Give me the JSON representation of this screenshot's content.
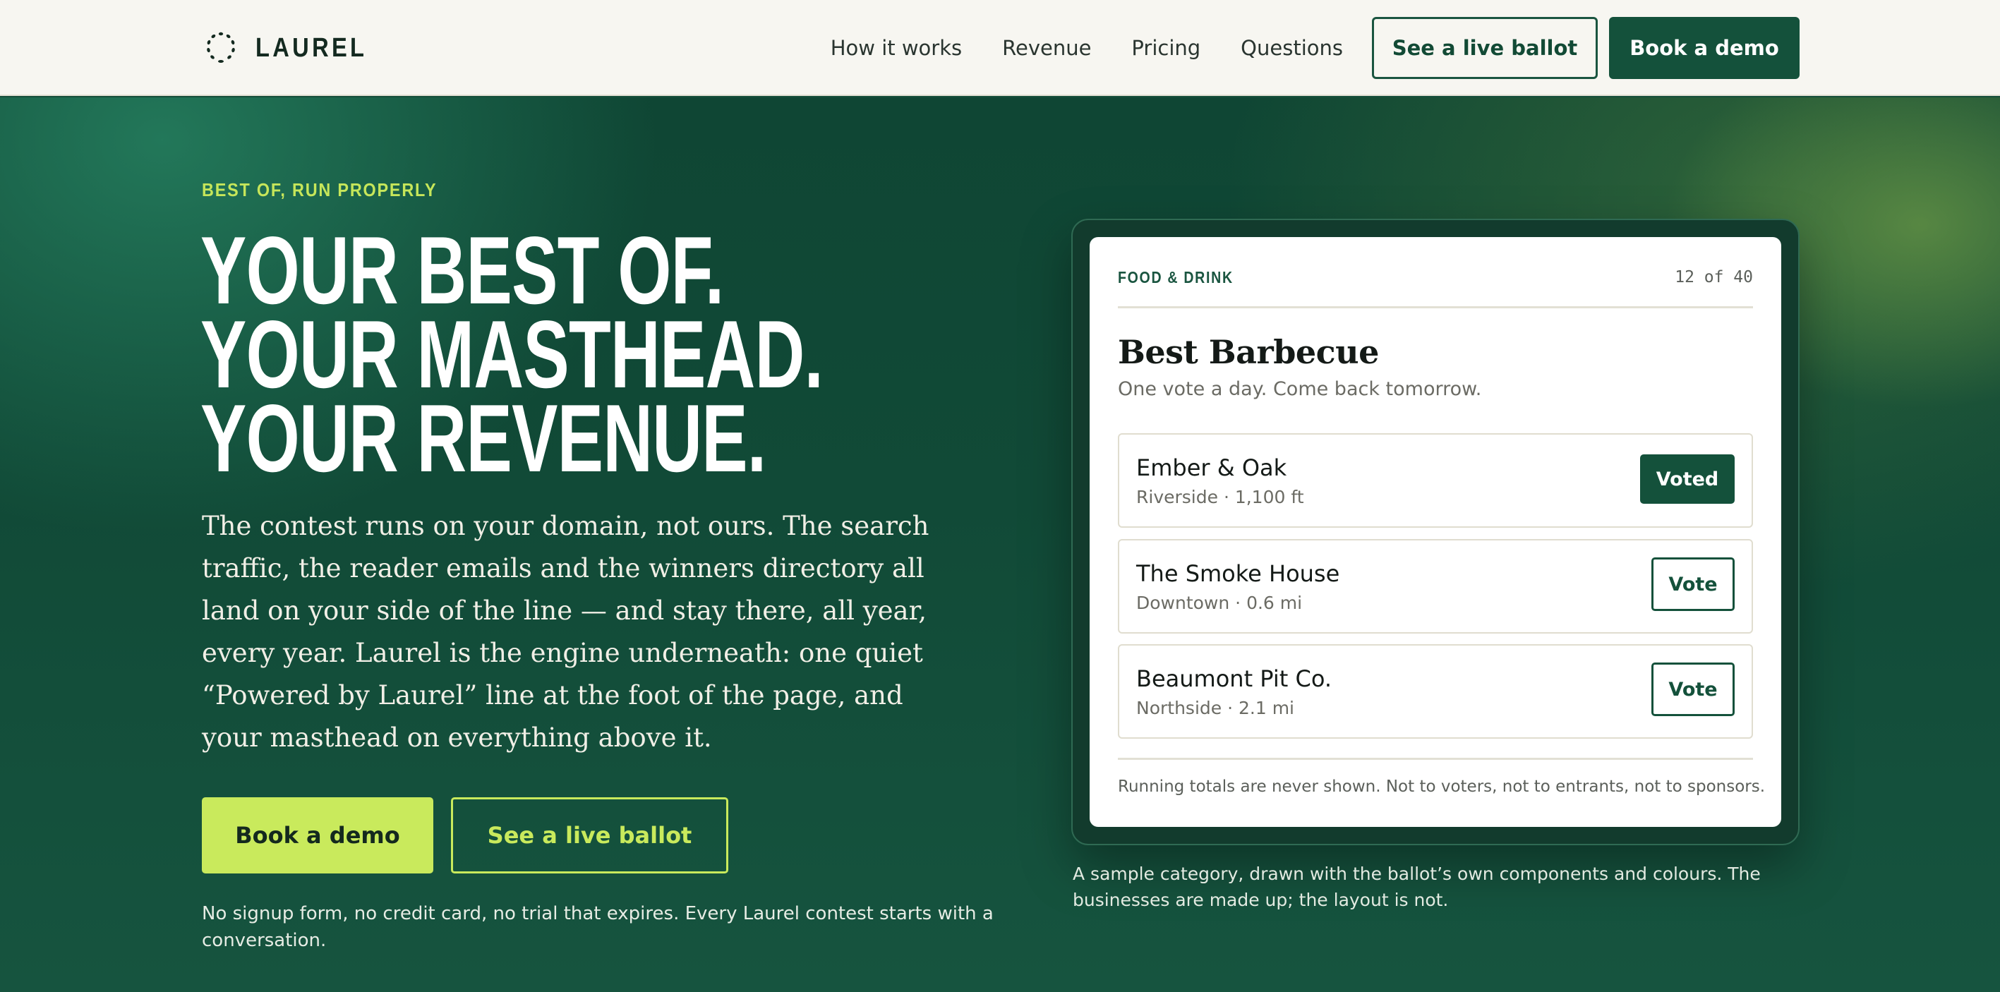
{
  "nav": {
    "brand": "LAUREL",
    "links": [
      "How it works",
      "Revenue",
      "Pricing",
      "Questions"
    ],
    "ballot_button": "See a live ballot",
    "demo_button": "Book a demo"
  },
  "hero": {
    "eyebrow": "BEST OF, RUN PROPERLY",
    "headline": [
      "YOUR BEST OF.",
      "YOUR MASTHEAD.",
      "YOUR REVENUE."
    ],
    "lede": "The contest runs on your domain, not ours. The search traffic, the reader emails and the winners directory all land on your side of the line — and stay there, all year, every year. Laurel is the engine underneath: one quiet “Powered by Laurel” line at the foot of the page, and your masthead on everything above it.",
    "demo_button": "Book a demo",
    "ballot_button": "See a live ballot",
    "fineprint": "No signup form, no credit card, no trial that expires. Every Laurel contest starts with a conversation."
  },
  "ballot": {
    "category": "FOOD & DRINK",
    "counter": "12 of 40",
    "title": "Best Barbecue",
    "subtitle": "One vote a day. Come back tomorrow.",
    "options": [
      {
        "name": "Ember & Oak",
        "meta": "Riverside · 1,100 ft",
        "button": "Voted",
        "state": "voted"
      },
      {
        "name": "The Smoke House",
        "meta": "Downtown · 0.6 mi",
        "button": "Vote",
        "state": "open"
      },
      {
        "name": "Beaumont Pit Co.",
        "meta": "Northside · 2.1 mi",
        "button": "Vote",
        "state": "open"
      }
    ],
    "footnote": "Running totals are never shown. Not to voters, not to entrants, not to sponsors.",
    "caption": "A sample category, drawn with the ballot’s own components and colours. The businesses are made up; the layout is not."
  },
  "colors": {
    "nav_bg": "#f7f6f1",
    "brand_green": "#14513b",
    "accent_lime": "#c9ea5c",
    "hero_bg": "#154e3a"
  },
  "icons": {
    "logo": "laurel-wreath-icon"
  }
}
